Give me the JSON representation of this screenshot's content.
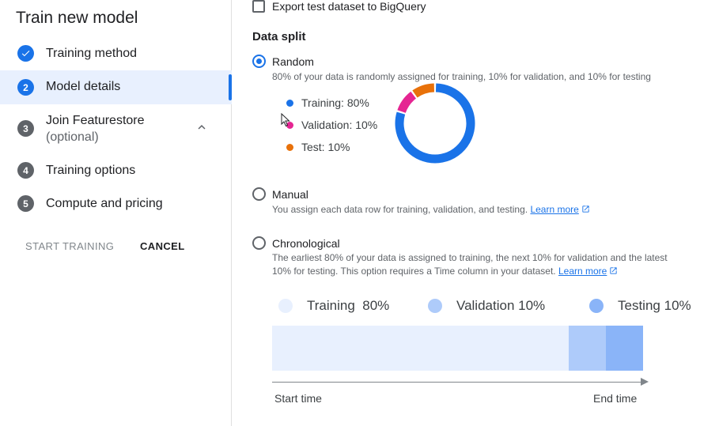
{
  "sidebar": {
    "title": "Train new model",
    "steps": [
      {
        "label": "Training method",
        "state": "done"
      },
      {
        "number": "2",
        "label": "Model details",
        "state": "active"
      },
      {
        "number": "3",
        "label": "Join Featurestore",
        "sublabel": "(optional)",
        "state": "pending"
      },
      {
        "number": "4",
        "label": "Training options",
        "state": "pending"
      },
      {
        "number": "5",
        "label": "Compute and pricing",
        "state": "pending"
      }
    ],
    "start_training": "START TRAINING",
    "cancel": "CANCEL"
  },
  "main": {
    "export_checkbox_label": "Export test dataset to BigQuery",
    "data_split_title": "Data split",
    "random": {
      "label": "Random",
      "description": "80% of your data is randomly assigned for training, 10% for validation, and 10% for testing",
      "legend": [
        {
          "label": "Training: 80%",
          "color": "#1a73e8",
          "value": 80
        },
        {
          "label": "Validation: 10%",
          "color": "#e52592",
          "value": 10
        },
        {
          "label": "Test: 10%",
          "color": "#e8710a",
          "value": 10
        }
      ]
    },
    "manual": {
      "label": "Manual",
      "description": "You assign each data row for training, validation, and testing.",
      "learn_more": "Learn more"
    },
    "chronological": {
      "label": "Chronological",
      "description_line1": "The earliest 80% of your data is assigned to training, the next 10% for validation and the latest",
      "description_line2": "10% for testing. This option requires a Time column in your dataset.",
      "learn_more": "Learn more"
    },
    "timeline": {
      "legend": [
        {
          "name": "Training",
          "pct": "80%",
          "color": "#e8f0fe",
          "value": 80
        },
        {
          "name": "Validation",
          "pct": "10%",
          "color": "#aecbfa",
          "value": 10
        },
        {
          "name": "Testing",
          "pct": "10%",
          "color": "#8ab4f8",
          "value": 10
        }
      ],
      "start_label": "Start time",
      "end_label": "End time"
    }
  }
}
